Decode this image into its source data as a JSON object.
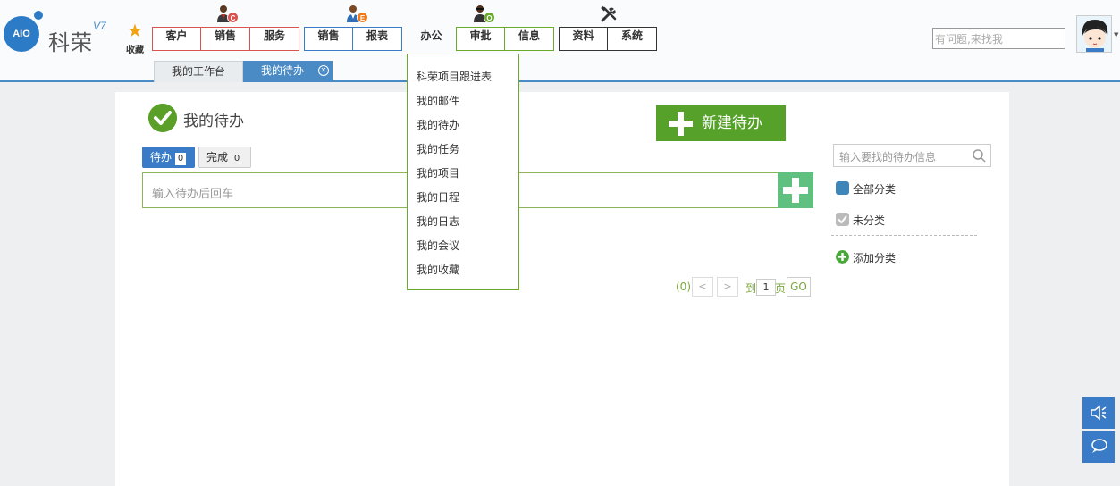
{
  "brand": {
    "logo_text": "AIO",
    "name": "科荣",
    "version": "V7"
  },
  "favorites": {
    "label": "收藏"
  },
  "nav_groups": [
    {
      "badge": "C",
      "badge_color": "#d9534f",
      "color": "#d9534f",
      "items": [
        "客户",
        "销售",
        "服务"
      ]
    },
    {
      "badge": "E",
      "badge_color": "#f07a1a",
      "color": "#3a7bc8",
      "items": [
        "销售",
        "报表"
      ]
    },
    {
      "badge": "O",
      "badge_color": "#6aaa2a",
      "color": "#6aaa2a",
      "items": [
        "办公",
        "审批",
        "信息"
      ],
      "active": "办公"
    },
    {
      "icon": "tools-icon",
      "color": "#333333",
      "items": [
        "资料",
        "系统"
      ]
    }
  ],
  "search": {
    "placeholder": "有问题,来找我"
  },
  "subtabs": [
    "我的工作台",
    "我的待办"
  ],
  "page": {
    "title": "我的待办",
    "new_button": "新建待办",
    "tabs": [
      {
        "label": "待办",
        "count": "0"
      },
      {
        "label": "完成",
        "count": "0"
      }
    ],
    "input_placeholder": "输入待办后回车",
    "pager": {
      "count": "(0)",
      "prev": "<",
      "next": ">",
      "goto": "到",
      "page": "1",
      "page_unit": "页",
      "go": "GO"
    }
  },
  "categories": {
    "search_placeholder": "输入要找的待办信息",
    "items": [
      {
        "label": "全部分类",
        "color": "#3f86b8"
      },
      {
        "label": "未分类",
        "color": "#bbbbbb"
      }
    ],
    "add_label": "添加分类",
    "add_color": "#4aa83a"
  },
  "dropdown": {
    "items": [
      "科荣项目跟进表",
      "我的邮件",
      "我的待办",
      "我的任务",
      "我的项目",
      "我的日程",
      "我的日志",
      "我的会议",
      "我的收藏"
    ]
  },
  "colors": {
    "accent": "#3a7bc8",
    "green": "#56a12a",
    "header_line": "#4a8bc6"
  }
}
